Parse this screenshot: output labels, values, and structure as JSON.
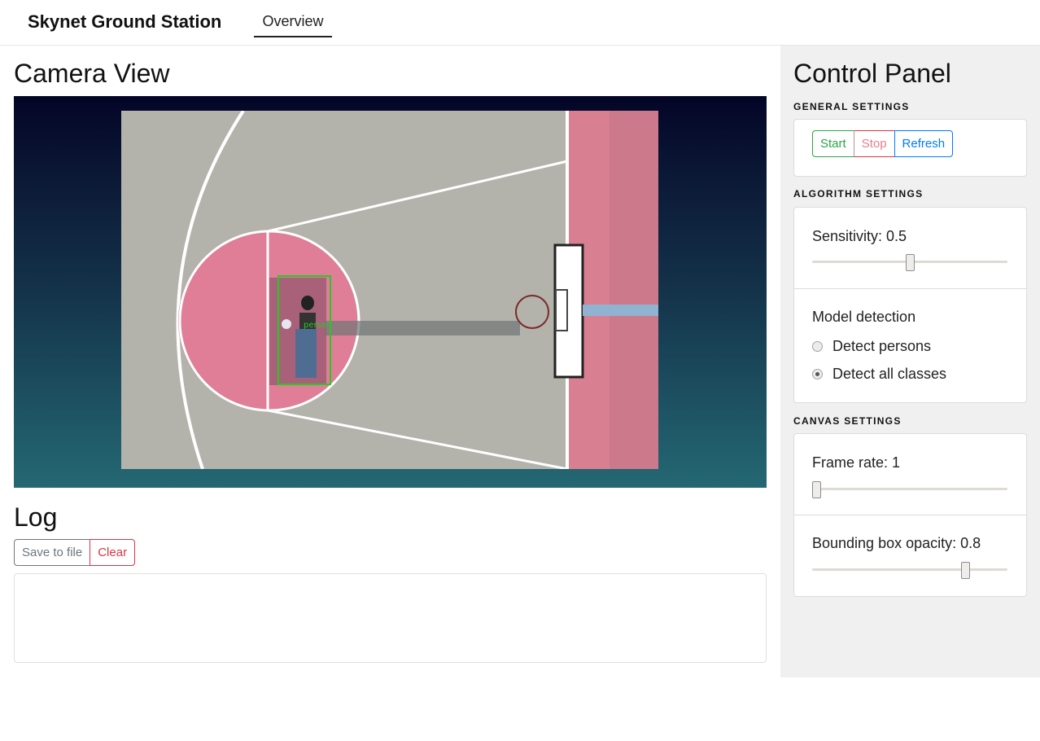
{
  "header": {
    "brand": "Skynet Ground Station",
    "tabs": [
      "Overview"
    ]
  },
  "camera": {
    "title": "Camera View",
    "detection_label": "person",
    "accent_box_color": "#22cc22"
  },
  "log": {
    "title": "Log",
    "save_label": "Save to file",
    "clear_label": "Clear",
    "content": ""
  },
  "panel": {
    "title": "Control Panel",
    "general": {
      "label": "GENERAL SETTINGS",
      "start": "Start",
      "stop": "Stop",
      "refresh": "Refresh"
    },
    "algorithm": {
      "label": "ALGORITHM SETTINGS",
      "sensitivity_label": "Sensitivity: 0.5",
      "sensitivity_value": 0.5,
      "model_detection_label": "Model detection",
      "options": [
        "Detect persons",
        "Detect all classes"
      ],
      "selected_option": "Detect all classes"
    },
    "canvas": {
      "label": "CANVAS SETTINGS",
      "frame_rate_label": "Frame rate: 1",
      "frame_rate_fraction": 0.0,
      "opacity_label": "Bounding box opacity: 0.8",
      "opacity_value": 0.8
    }
  },
  "colors": {
    "success": "#28a745",
    "danger": "#dc3545",
    "primary": "#007bff",
    "secondary": "#6c757d",
    "panel_bg": "#f0f0f0"
  }
}
